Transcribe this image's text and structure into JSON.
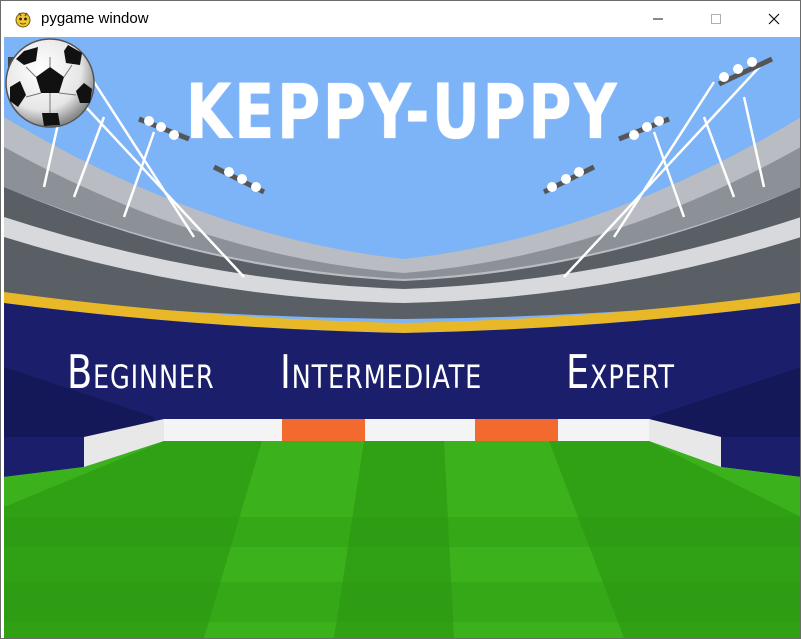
{
  "window": {
    "title": "pygame window",
    "minimize_glyph": "—",
    "maximize_glyph": "☐",
    "close_glyph": "✕"
  },
  "game": {
    "title": "KEPPY-UPPY",
    "levels": [
      "Beginner",
      "Intermediate",
      "Expert"
    ],
    "sound_icon": "speaker-icon",
    "ball_icon": "soccer-ball-icon"
  },
  "colors": {
    "sky": "#7db3f7",
    "field_light": "#3bb21b",
    "field_dark": "#2a9612",
    "banner": "#1b1f6b",
    "banner_stripe": "#e8b829",
    "ad_orange": "#f36a2e"
  }
}
